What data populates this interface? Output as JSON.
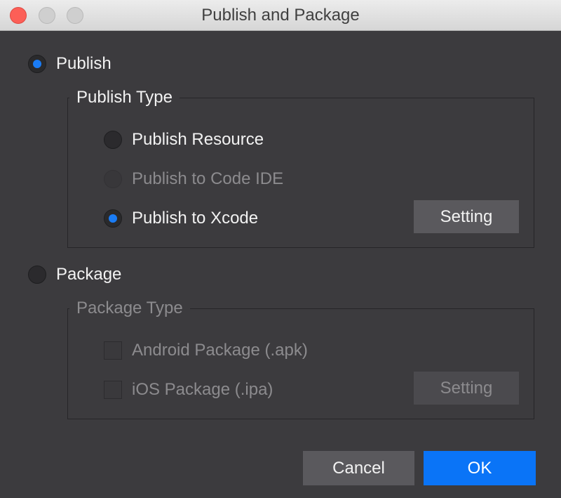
{
  "window": {
    "title": "Publish and Package"
  },
  "publish": {
    "label": "Publish",
    "selected": true,
    "group_title": "Publish Type",
    "options": [
      {
        "label": "Publish Resource",
        "selected": false,
        "enabled": true
      },
      {
        "label": "Publish to Code IDE",
        "selected": false,
        "enabled": false
      },
      {
        "label": "Publish to Xcode",
        "selected": true,
        "enabled": true
      }
    ],
    "setting_label": "Setting"
  },
  "package": {
    "label": "Package",
    "selected": false,
    "group_title": "Package Type",
    "options": [
      {
        "label": "Android Package (.apk)",
        "checked": false,
        "enabled": false
      },
      {
        "label": "iOS Package (.ipa)",
        "checked": false,
        "enabled": false
      }
    ],
    "setting_label": "Setting"
  },
  "footer": {
    "cancel_label": "Cancel",
    "ok_label": "OK"
  },
  "colors": {
    "accent": "#0a74f7",
    "background": "#3c3b3e",
    "close_button": "#fc5f57"
  }
}
